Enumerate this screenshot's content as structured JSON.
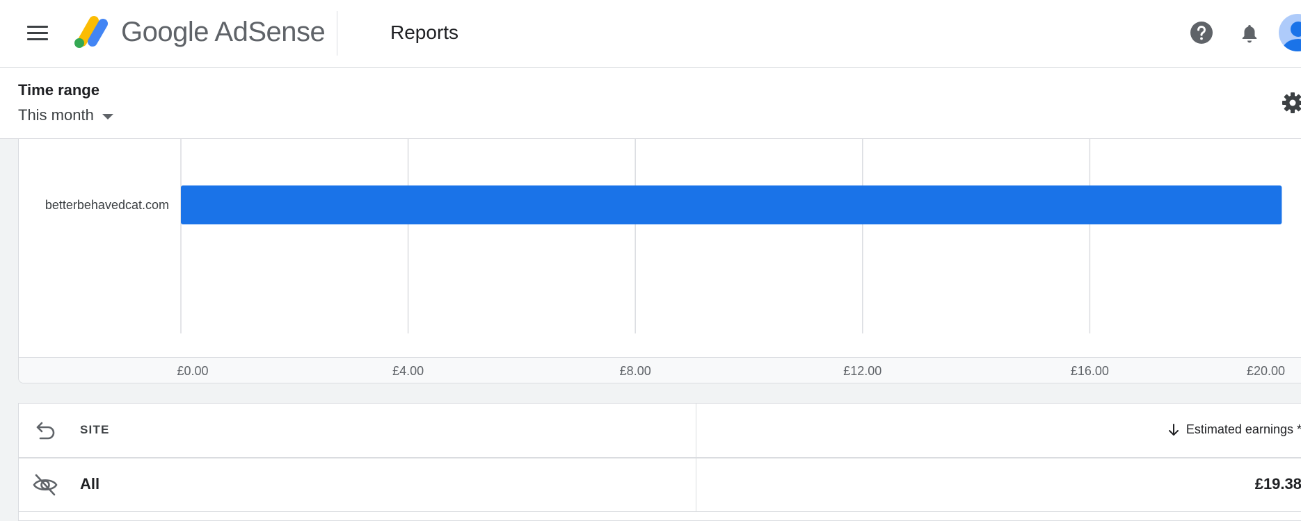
{
  "header": {
    "brand": "Google AdSense",
    "page_title": "Reports"
  },
  "filters": {
    "time_range_label": "Time range",
    "time_range_value": "This month"
  },
  "chart_data": {
    "type": "bar",
    "orientation": "horizontal",
    "categories": [
      "betterbehavedcat.com"
    ],
    "values": [
      19.38
    ],
    "xlim": [
      0,
      20
    ],
    "x_ticks": [
      "£0.00",
      "£4.00",
      "£8.00",
      "£12.00",
      "£16.00",
      "£20.00"
    ],
    "grid": true,
    "bar_color": "#1a73e8"
  },
  "table": {
    "columns": {
      "site": "SITE",
      "earnings": "Estimated earnings",
      "earnings_suffix": "*"
    },
    "rows": [
      {
        "site": "All",
        "earnings": "£19.38"
      }
    ]
  },
  "icons": {
    "menu": "menu-icon",
    "help": "help-icon",
    "notifications": "bell-icon",
    "settings": "gear-icon",
    "back": "back-arrow-icon",
    "sort": "arrow-down-icon",
    "visibility": "eye-off-icon"
  }
}
